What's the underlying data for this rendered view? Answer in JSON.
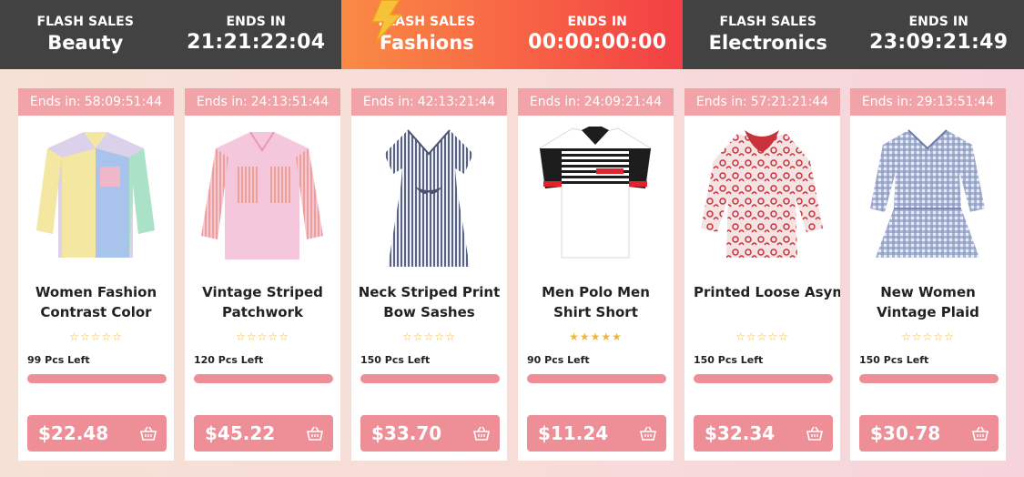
{
  "tabs": [
    {
      "kicker": "FLASH SALES",
      "title": "Beauty",
      "ends_label": "ENDS IN",
      "timer": "21:21:22:04",
      "active": false
    },
    {
      "kicker": "FLASH SALES",
      "title": "Fashions",
      "ends_label": "ENDS IN",
      "timer": "00:00:00:00",
      "active": true
    },
    {
      "kicker": "FLASH SALES",
      "title": "Electronics",
      "ends_label": "ENDS IN",
      "timer": "23:09:21:49",
      "active": false
    }
  ],
  "products": [
    {
      "ends_prefix": "Ends in:",
      "ends_time": "58:09:51:44",
      "name": "Women Fashion Contrast Color",
      "stock": "99 Pcs Left",
      "price": "$22.48",
      "rating": 0,
      "image_icon": "shirt-contrast-icon"
    },
    {
      "ends_prefix": "Ends in:",
      "ends_time": "24:13:51:44",
      "name": "Vintage Striped Patchwork",
      "stock": "120 Pcs Left",
      "price": "$45.22",
      "rating": 0,
      "image_icon": "shirt-striped-icon"
    },
    {
      "ends_prefix": "Ends in:",
      "ends_time": "42:13:21:44",
      "name": "Neck Striped Print Bow Sashes",
      "stock": "150 Pcs Left",
      "price": "$33.70",
      "rating": 0,
      "image_icon": "dress-striped-icon"
    },
    {
      "ends_prefix": "Ends in:",
      "ends_time": "24:09:21:44",
      "name": "Men Polo Men Shirt Short",
      "stock": "90 Pcs Left",
      "price": "$11.24",
      "rating": 5,
      "image_icon": "polo-shirt-icon"
    },
    {
      "ends_prefix": "Ends in:",
      "ends_time": "57:21:21:44",
      "name": "Printed Loose Asymr",
      "stock": "150 Pcs Left",
      "price": "$32.34",
      "rating": 0,
      "image_icon": "blouse-print-icon"
    },
    {
      "ends_prefix": "Ends in:",
      "ends_time": "29:13:51:44",
      "name": "New Women Vintage Plaid",
      "stock": "150 Pcs Left",
      "price": "$30.78",
      "rating": 0,
      "image_icon": "dress-plaid-icon"
    }
  ],
  "colors": {
    "accent": "#ee8e97",
    "header_dark": "#424242",
    "ends_bg": "#f1a3a7",
    "star": "#f3b43a",
    "bolt": "#f6a623"
  },
  "icons": {
    "bolt": "lightning-bolt-icon",
    "basket": "basket-icon"
  }
}
